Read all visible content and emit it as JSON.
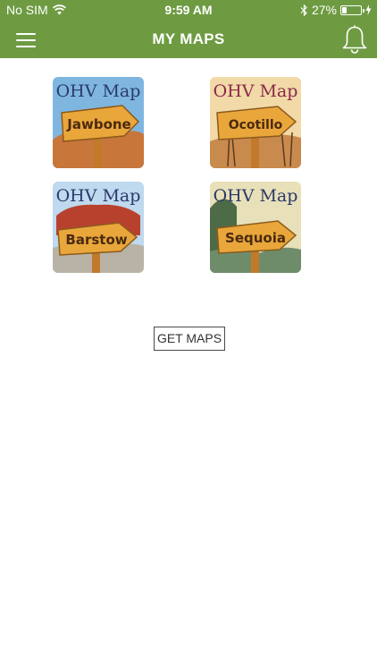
{
  "status_bar": {
    "carrier": "No SIM",
    "time": "9:59 AM",
    "battery_percent": "27%",
    "battery_level": 0.27
  },
  "nav": {
    "title": "MY MAPS",
    "menu_icon": "hamburger-menu-icon",
    "bell_icon": "bell-icon"
  },
  "maps": [
    {
      "header": "OHV Map",
      "name": "Jawbone",
      "header_color": "#2b3a6b",
      "sky": "#7fb6e0",
      "ground": "#c8763a"
    },
    {
      "header": "OHV Map",
      "name": "Ocotillo",
      "header_color": "#8a2a4a",
      "sky": "#f2d9a8",
      "ground": "#c98a4e"
    },
    {
      "header": "OHV Map",
      "name": "Barstow",
      "header_color": "#2b3a6b",
      "sky": "#bfd9ee",
      "ground": "#b9b3a6"
    },
    {
      "header": "OHV Map",
      "name": "Sequoia",
      "header_color": "#2b3a6b",
      "sky": "#e8e0b8",
      "ground": "#6f8c6a"
    }
  ],
  "get_maps_label": "GET MAPS",
  "colors": {
    "accent_green": "#6e9b42",
    "sign_wood": "#e9a63a"
  }
}
